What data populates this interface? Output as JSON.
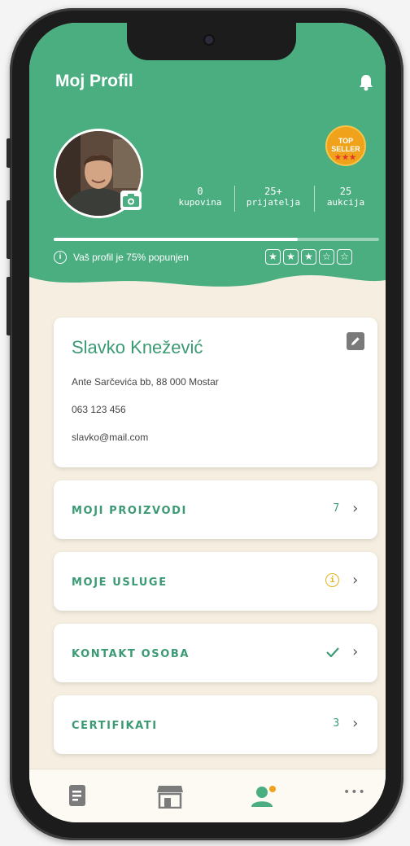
{
  "header": {
    "title": "Moj Profil",
    "progress_percent": 75,
    "profile_note": "Vaš profil je 75% popunjen",
    "badge": {
      "line1": "TOP",
      "line2": "SELLER",
      "stars": "★★★"
    },
    "rating_stars": {
      "filled": 3,
      "total": 5
    },
    "stats": [
      {
        "value": "0",
        "label": "kupovina"
      },
      {
        "value": "25+",
        "label": "prijatelja"
      },
      {
        "value": "25",
        "label": "aukcija"
      }
    ]
  },
  "profile": {
    "name": "Slavko Knežević",
    "address": "Ante Sarčevića bb, 88 000 Mostar",
    "phone": "063 123 456",
    "email": "slavko@mail.com"
  },
  "menu": [
    {
      "label": "MOJI PROIZVODI",
      "value": "7",
      "status_icon": "none"
    },
    {
      "label": "MOJE USLUGE",
      "value": "",
      "status_icon": "warning-icon"
    },
    {
      "label": "KONTAKT OSOBA",
      "value": "",
      "status_icon": "check-icon"
    },
    {
      "label": "CERTIFIKATI",
      "value": "3",
      "status_icon": "none"
    }
  ],
  "nav": {
    "items": [
      "document-icon",
      "store-icon",
      "profile-icon",
      "more-icon"
    ],
    "active_index": 2,
    "more_glyph": "•••"
  },
  "colors": {
    "primary": "#4aae80",
    "background": "#f6efe1",
    "accent_text": "#3b9a73",
    "badge": "#f0a21b",
    "warning": "#e0b21c"
  }
}
